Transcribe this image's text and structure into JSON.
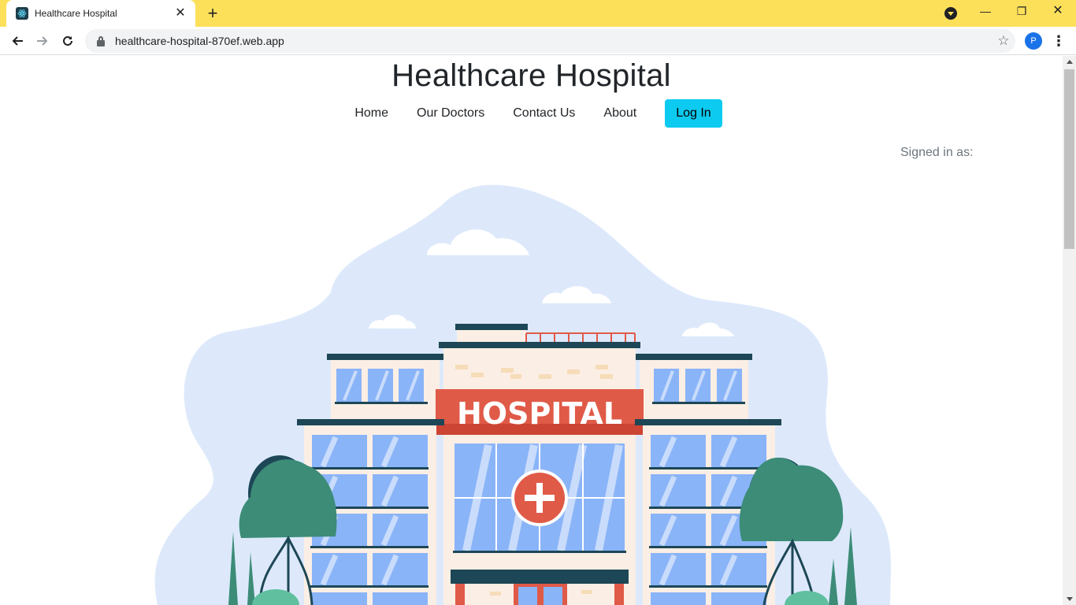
{
  "browser": {
    "tab_title": "Healthcare Hospital",
    "url": "healthcare-hospital-870ef.web.app",
    "profile_initial": "P",
    "icons": [
      "react-favicon-icon",
      "close-icon",
      "plus-icon",
      "minimize-icon",
      "restore-icon",
      "close-window-icon",
      "back-arrow-icon",
      "forward-arrow-icon",
      "reload-icon",
      "lock-icon",
      "star-icon",
      "kebab-menu-icon"
    ]
  },
  "site": {
    "title": "Healthcare Hospital",
    "nav": {
      "home": "Home",
      "doctors": "Our Doctors",
      "contact": "Contact Us",
      "about": "About",
      "login": "Log In"
    },
    "signed_in_label": "Signed in as:",
    "hero_sign_text": "HOSPITAL"
  },
  "colors": {
    "tabbar": "#fde05a",
    "login_button": "#0dcaf0",
    "hero_blob": "#dde9fb",
    "sign_red": "#e05a48",
    "tree_green": "#3c8c78",
    "window_blue": "#8ab4f8"
  }
}
